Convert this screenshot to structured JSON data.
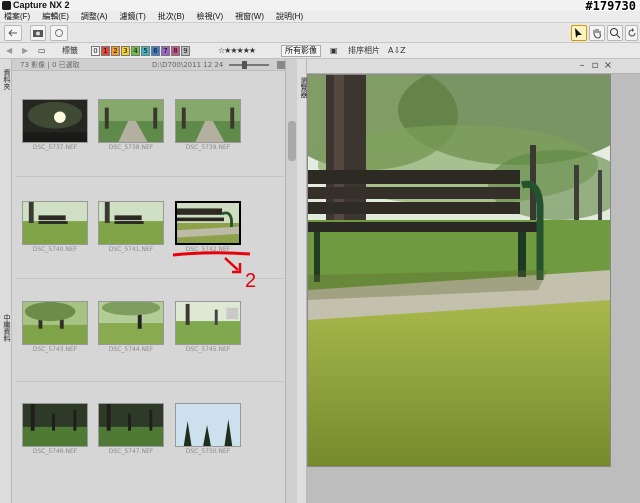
{
  "app": {
    "title": "Capture NX 2",
    "watermark": "#179730"
  },
  "menu": [
    {
      "label": "檔案(F)"
    },
    {
      "label": "編輯(E)"
    },
    {
      "label": "調整(A)"
    },
    {
      "label": "濾鏡(T)"
    },
    {
      "label": "批次(B)"
    },
    {
      "label": "檢視(V)"
    },
    {
      "label": "視窗(W)"
    },
    {
      "label": "說明(H)"
    }
  ],
  "toolbar": {
    "tools": [
      "back-icon",
      "forward-icon",
      "camera-icon",
      "batch-icon",
      "folder-icon",
      "arrow-icon",
      "hand-icon",
      "zoom-icon",
      "rotate-icon"
    ],
    "active_tool": "arrow-icon"
  },
  "browser_toolbar": {
    "label_text": "標籤",
    "label_numbers": [
      "0",
      "1",
      "2",
      "3",
      "4",
      "5",
      "6",
      "7",
      "8",
      "9"
    ],
    "label_colors": [
      "#f2f2f2",
      "#e8463a",
      "#f39c2a",
      "#f3d02a",
      "#6fbf4a",
      "#3fb6c2",
      "#3e7fcf",
      "#9c63c9",
      "#c7568e",
      "#bdbdbd"
    ],
    "stars": "☆★★★★★",
    "filter_label": "所有影像",
    "sort_label": "排序相片",
    "sort_short": "A⇩Z"
  },
  "browser": {
    "status_left": "73 影像 | 0 已選取",
    "status_right": "D:\\D700\\2011 12 24",
    "thumbnails": [
      {
        "file": "DSC_5737.NEF",
        "scene": "dark-sun"
      },
      {
        "file": "DSC_5738.NEF",
        "scene": "path"
      },
      {
        "file": "DSC_5739.NEF",
        "scene": "path"
      },
      {
        "file": "DSC_5740.NEF",
        "scene": "bench-lawn"
      },
      {
        "file": "DSC_5741.NEF",
        "scene": "bench-lawn"
      },
      {
        "file": "DSC_5742.NEF",
        "scene": "bench-close",
        "selected": true
      },
      {
        "file": "DSC_5743.NEF",
        "scene": "trees"
      },
      {
        "file": "DSC_5744.NEF",
        "scene": "person"
      },
      {
        "file": "DSC_5745.NEF",
        "scene": "lawn-bright"
      },
      {
        "file": "DSC_5746.NEF",
        "scene": "dark-lawn"
      },
      {
        "file": "DSC_5747.NEF",
        "scene": "dark-lawn"
      },
      {
        "file": "DSC_5750.NEF",
        "scene": "sky-trees"
      }
    ]
  },
  "side_tabs": {
    "left_top": "資料夾",
    "left_bottom": "中繼資料",
    "middle": "瀏覽器"
  },
  "annotation": {
    "number": "2",
    "color": "#e8000b"
  }
}
